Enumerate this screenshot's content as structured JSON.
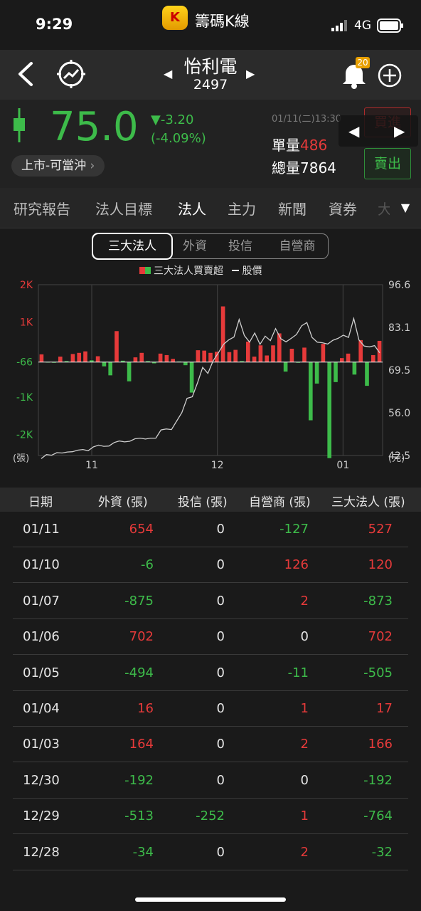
{
  "status_bar": {
    "time": "9:29",
    "app_badge": "K",
    "app_name": "籌碼K線",
    "network": "4G"
  },
  "header": {
    "stock_name": "怡利電",
    "stock_code": "2497",
    "notification_count": "20"
  },
  "quote": {
    "price": "75.0",
    "change": "▼-3.20",
    "change_pct": "(-4.09%)",
    "market_tag": "上市-可當沖",
    "timestamp": "01/11(二)13:30",
    "unit_vol_label": "單量",
    "unit_vol": "486",
    "total_vol_label": "總量",
    "total_vol": "7864",
    "buy_label": "買進",
    "sell_label": "賣出"
  },
  "tabs": [
    "研究報告",
    "法人目標",
    "法人",
    "主力",
    "新聞",
    "資券",
    "大"
  ],
  "active_tab": 2,
  "segments": [
    "三大法人",
    "外資",
    "投信",
    "自營商"
  ],
  "active_segment": 0,
  "colors": {
    "up": "#e63a3a",
    "down": "#3dbb4a",
    "line": "#cfcfcf",
    "bg": "#1a1a1a"
  },
  "chart_data": {
    "type": "bar",
    "legend": [
      {
        "name": "三大法人買賣超",
        "type": "bar"
      },
      {
        "name": "股價",
        "type": "line"
      }
    ],
    "left_axis": {
      "ticks": [
        "2K",
        "1K",
        "-66",
        "-1K",
        "-2K"
      ],
      "tick_values": [
        2000,
        1000,
        -66,
        -1000,
        -2000
      ],
      "unit": "(張)"
    },
    "right_axis": {
      "ticks": [
        "96.6",
        "83.1",
        "69.5",
        "56.0",
        "42.5"
      ],
      "tick_values": [
        96.6,
        83.1,
        69.5,
        56.0,
        42.5
      ],
      "unit": "(元)"
    },
    "x_ticks": [
      "11",
      "12",
      "01"
    ],
    "ylim": [
      -2560,
      2000
    ],
    "bars": [
      140,
      -60,
      -70,
      80,
      -40,
      150,
      180,
      220,
      -20,
      90,
      -180,
      -420,
      760,
      -30,
      -580,
      60,
      180,
      -40,
      -100,
      160,
      120,
      20,
      -50,
      -150,
      -880,
      250,
      240,
      180,
      210,
      1420,
      200,
      260,
      -40,
      480,
      80,
      380,
      110,
      380,
      700,
      -320,
      290,
      -80,
      320,
      -1620,
      -640,
      420,
      -2630,
      -600,
      40,
      160,
      -400,
      520,
      -700,
      120,
      500
    ],
    "price_line": [
      41.5,
      42.8,
      42.6,
      43.4,
      43.3,
      43.6,
      43.7,
      44.2,
      44.4,
      44.0,
      45.2,
      45.8,
      45.4,
      45.5,
      46.6,
      47.1,
      46.8,
      47.0,
      47.8,
      48.0,
      47.7,
      48.0,
      48.0,
      50.6,
      50.9,
      50.7,
      53.4,
      56.1,
      60.6,
      61.1,
      65.5,
      70.4,
      68.5,
      72.5,
      75.0,
      77.7,
      79.1,
      80.0,
      85.6,
      80.5,
      78.4,
      81.3,
      77.7,
      80.3,
      78.9,
      82.7,
      79.5,
      78.5,
      79.6,
      80.8,
      83.6,
      84.6,
      79.9,
      78.4,
      78.2,
      77.8,
      79.0,
      79.6,
      80.6,
      79.9,
      85.9,
      79.1,
      77.2,
      76.9,
      77.3,
      75.0
    ]
  },
  "table": {
    "headers": [
      "日期",
      "外資 (張)",
      "投信 (張)",
      "自營商 (張)",
      "三大法人 (張)"
    ],
    "rows": [
      {
        "date": "01/11",
        "values": [
          "654",
          "0",
          "-127",
          "527"
        ]
      },
      {
        "date": "01/10",
        "values": [
          "-6",
          "0",
          "126",
          "120"
        ]
      },
      {
        "date": "01/07",
        "values": [
          "-875",
          "0",
          "2",
          "-873"
        ]
      },
      {
        "date": "01/06",
        "values": [
          "702",
          "0",
          "0",
          "702"
        ]
      },
      {
        "date": "01/05",
        "values": [
          "-494",
          "0",
          "-11",
          "-505"
        ]
      },
      {
        "date": "01/04",
        "values": [
          "16",
          "0",
          "1",
          "17"
        ]
      },
      {
        "date": "01/03",
        "values": [
          "164",
          "0",
          "2",
          "166"
        ]
      },
      {
        "date": "12/30",
        "values": [
          "-192",
          "0",
          "0",
          "-192"
        ]
      },
      {
        "date": "12/29",
        "values": [
          "-513",
          "-252",
          "1",
          "-764"
        ]
      },
      {
        "date": "12/28",
        "values": [
          "-34",
          "0",
          "2",
          "-32"
        ]
      }
    ]
  }
}
